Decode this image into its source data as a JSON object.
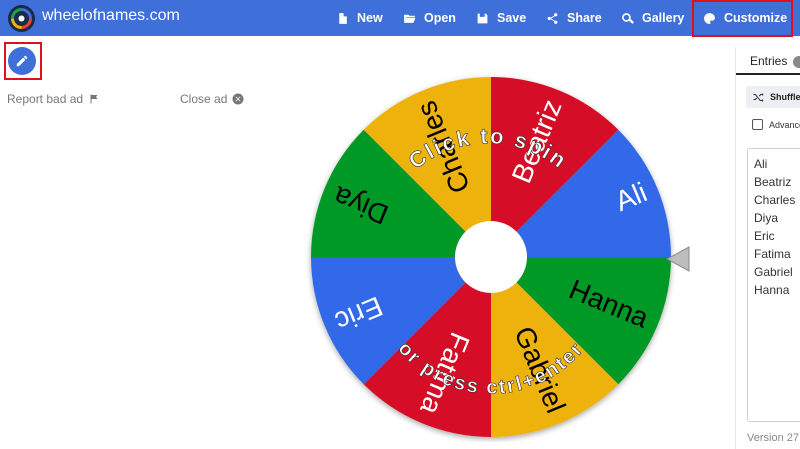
{
  "header": {
    "site_title": "wheelofnames.com",
    "nav": {
      "new": "New",
      "open": "Open",
      "save": "Save",
      "share": "Share",
      "gallery": "Gallery",
      "customize": "Customize"
    }
  },
  "ads": {
    "report": "Report bad ad",
    "close": "Close ad"
  },
  "wheel": {
    "spin_text": "Click to spin",
    "press_text": "or press ctrl+enter",
    "segments": [
      {
        "label": "Ali",
        "color": "#3369e8"
      },
      {
        "label": "Hanna",
        "color": "#009925"
      },
      {
        "label": "Gabriel",
        "color": "#eeb211"
      },
      {
        "label": "Fatima",
        "color": "#d50f25"
      },
      {
        "label": "Eric",
        "color": "#3369e8"
      },
      {
        "label": "Diya",
        "color": "#009925"
      },
      {
        "label": "Charles",
        "color": "#eeb211"
      },
      {
        "label": "Beatriz",
        "color": "#d50f25"
      }
    ]
  },
  "sidebar": {
    "tab_entries": "Entries",
    "shuffle": "Shuffle",
    "advanced": "Advanced",
    "entries": [
      "Ali",
      "Beatriz",
      "Charles",
      "Diya",
      "Eric",
      "Fatima",
      "Gabriel",
      "Hanna"
    ],
    "version": "Version 27"
  },
  "colors": {
    "accent": "#3f6fd8",
    "highlight": "#e0101a"
  }
}
